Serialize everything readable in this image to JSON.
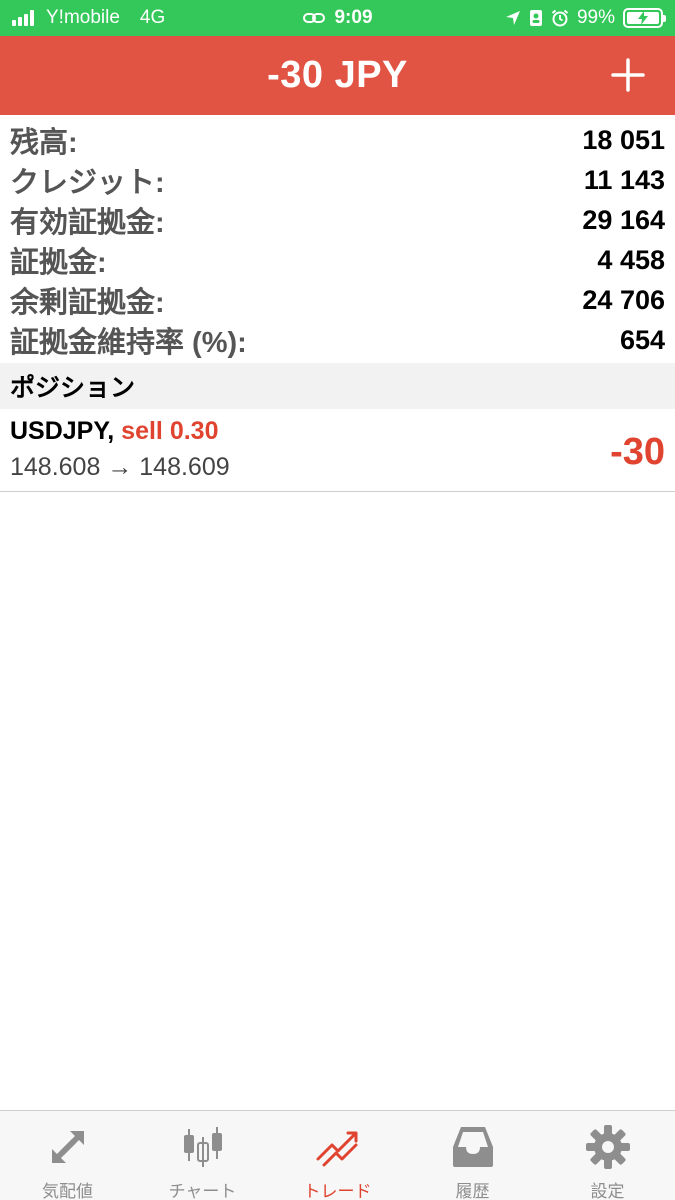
{
  "status_bar": {
    "carrier": "Y!mobile",
    "network": "4G",
    "time": "9:09",
    "battery_percent": "99%",
    "battery_level": 0.99
  },
  "header": {
    "title": "-30 JPY",
    "add_icon": "plus-icon"
  },
  "account": [
    {
      "label": "残高:",
      "value": "18 051"
    },
    {
      "label": "クレジット:",
      "value": "11 143"
    },
    {
      "label": "有効証拠金:",
      "value": "29 164"
    },
    {
      "label": "証拠金:",
      "value": "4 458"
    },
    {
      "label": "余剰証拠金:",
      "value": "24 706"
    },
    {
      "label": "証拠金維持率 (%):",
      "value": "654"
    }
  ],
  "positions_section": {
    "title": "ポジション"
  },
  "positions": [
    {
      "symbol": "USDJPY,",
      "type": "sell 0.30",
      "prices": "148.608 → 148.609",
      "profit": "-30"
    }
  ],
  "tabs": [
    {
      "label": "気配値",
      "icon": "quotes-icon",
      "active": false
    },
    {
      "label": "チャート",
      "icon": "chart-icon",
      "active": false
    },
    {
      "label": "トレード",
      "icon": "trade-icon",
      "active": true
    },
    {
      "label": "履歴",
      "icon": "history-icon",
      "active": false
    },
    {
      "label": "設定",
      "icon": "settings-icon",
      "active": false
    }
  ],
  "colors": {
    "status_bar": "#34c759",
    "header": "#e15444",
    "accent_red": "#e0432f",
    "inactive_tab": "#8e8e8e"
  }
}
